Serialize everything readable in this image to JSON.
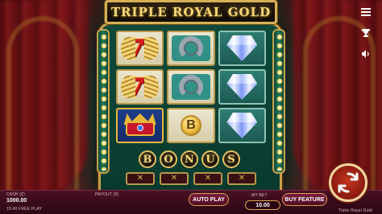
{
  "game": {
    "title": "TRIPLE ROYAL GOLD",
    "bonus_letters": [
      "B",
      "O",
      "N",
      "U",
      "S"
    ]
  },
  "reels": [
    {
      "symbols": [
        "seven",
        "seven",
        "crown"
      ]
    },
    {
      "symbols": [
        "horseshoe",
        "horseshoe",
        "b-coin"
      ]
    },
    {
      "symbols": [
        "diamond",
        "diamond",
        "diamond"
      ]
    }
  ],
  "symbol_text": {
    "seven": "77",
    "b_coin": "B"
  },
  "side_controls": {
    "menu_icon": "menu-icon",
    "trophy_icon": "trophy-icon",
    "sound_icon": "sound-icon"
  },
  "bottom_bar": {
    "cash_label": "CASH (€)",
    "cash_value": "1000.00",
    "mode_label": "15:40  FREE PLAY",
    "payout_label": "PAYOUT (€)",
    "payout_value": "",
    "auto_play_label": "AUTO PLAY",
    "bet_label": "MY BET",
    "bet_value": "10.00",
    "buy_feature_label": "BUY FEATURE",
    "game_name_footer": "Triple Royal Gold"
  },
  "colors": {
    "accent_gold": "#d8b156",
    "machine_green": "#0d4a3a",
    "bar_maroon": "#4a1024",
    "spin_red": "#c3361e"
  }
}
